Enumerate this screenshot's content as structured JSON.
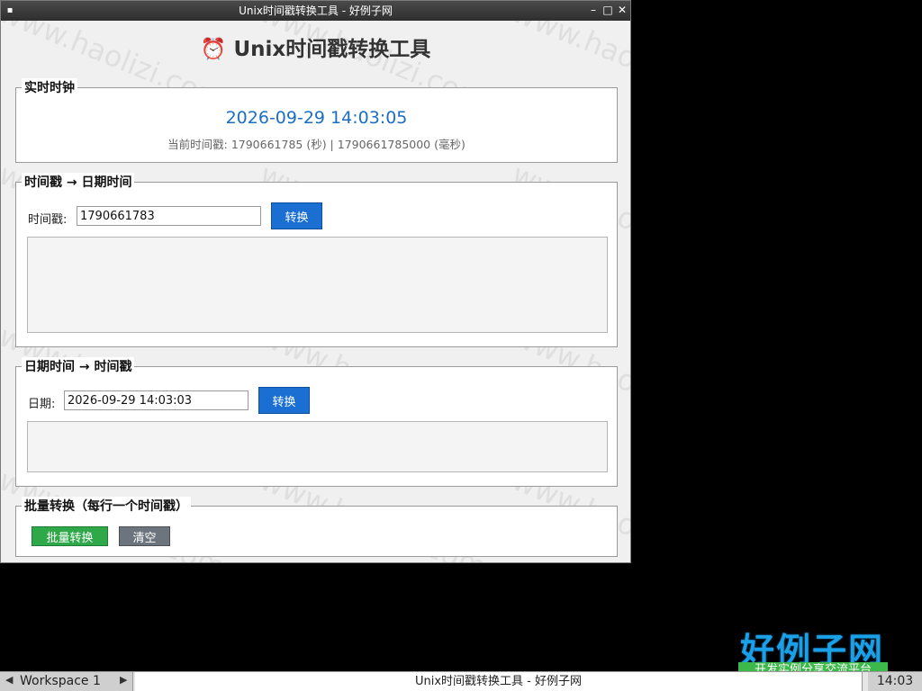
{
  "window": {
    "title": "Unix时间戳转换工具 - 好例子网",
    "controls": {
      "minimize": "–",
      "maximize": "□",
      "close": "✕"
    }
  },
  "watermark": "www.haolizi.com",
  "app": {
    "icon": "⏰",
    "title": "Unix时间戳转换工具"
  },
  "clock_group": {
    "label": "实时时钟",
    "datetime": "2026-09-29 14:03:05",
    "subtitle": "当前时间戳: 1790661785 (秒) | 1790661785000 (毫秒)"
  },
  "ts_to_date": {
    "label": "时间戳 → 日期时间",
    "field_label": "时间戳:",
    "value": "1790661783",
    "button": "转换",
    "output": ""
  },
  "date_to_ts": {
    "label": "日期时间 → 时间戳",
    "field_label": "日期:",
    "value": "2026-09-29 14:03:03",
    "button": "转换",
    "output": ""
  },
  "batch": {
    "label": "批量转换（每行一个时间戳）",
    "convert_button": "批量转换",
    "clear_button": "清空"
  },
  "taskbar": {
    "workspace": "Workspace 1",
    "task_title": "Unix时间戳转换工具 - 好例子网",
    "time": "14:03"
  },
  "brand": {
    "name": "好例子网",
    "slogan": "开发实例分享交流平台"
  },
  "colors": {
    "accent_blue": "#1b6ed2",
    "clock_blue": "#1a6fc4",
    "batch_green": "#2fa84a",
    "clear_gray": "#6c757d"
  }
}
